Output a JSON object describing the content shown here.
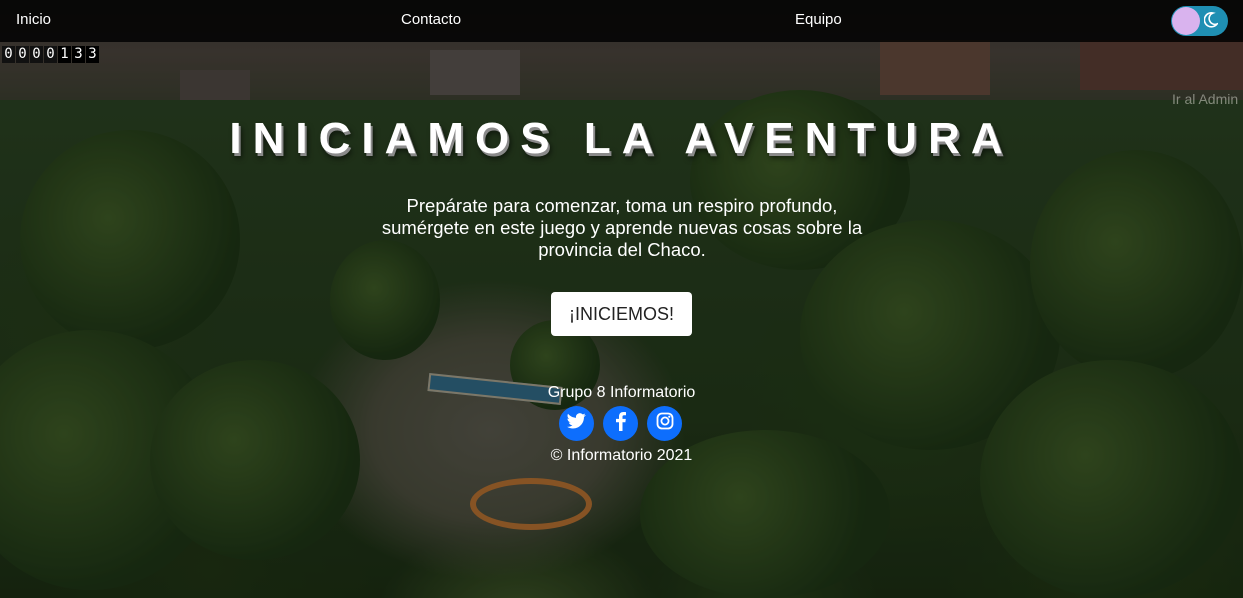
{
  "nav": {
    "items": [
      {
        "label": "Inicio"
      },
      {
        "label": "Contacto"
      },
      {
        "label": "Equipo"
      }
    ]
  },
  "theme_toggle": {
    "icon": "moon-icon",
    "mode": "light"
  },
  "counter": {
    "digits": [
      "0",
      "0",
      "0",
      "0",
      "1",
      "3",
      "3"
    ],
    "value": 133
  },
  "admin": {
    "label": "Ir al Admin"
  },
  "hero": {
    "title": "INICIAMOS LA AVENTURA",
    "subtitle": "Prepárate para comenzar, toma un respiro profundo, sumérgete en este juego y aprende nuevas cosas sobre la provincia del Chaco.",
    "cta_label": "¡INICIEMOS!"
  },
  "footer": {
    "group": "Grupo 8 Informatorio",
    "social": [
      {
        "icon": "twitter-icon"
      },
      {
        "icon": "facebook-icon"
      },
      {
        "icon": "instagram-icon"
      }
    ],
    "copyright": "© Informatorio 2021"
  },
  "colors": {
    "navbar": "#000000",
    "social": "#0d6efd",
    "toggle_track": "#1f8fb3",
    "toggle_knob": "#d9b3ee"
  }
}
